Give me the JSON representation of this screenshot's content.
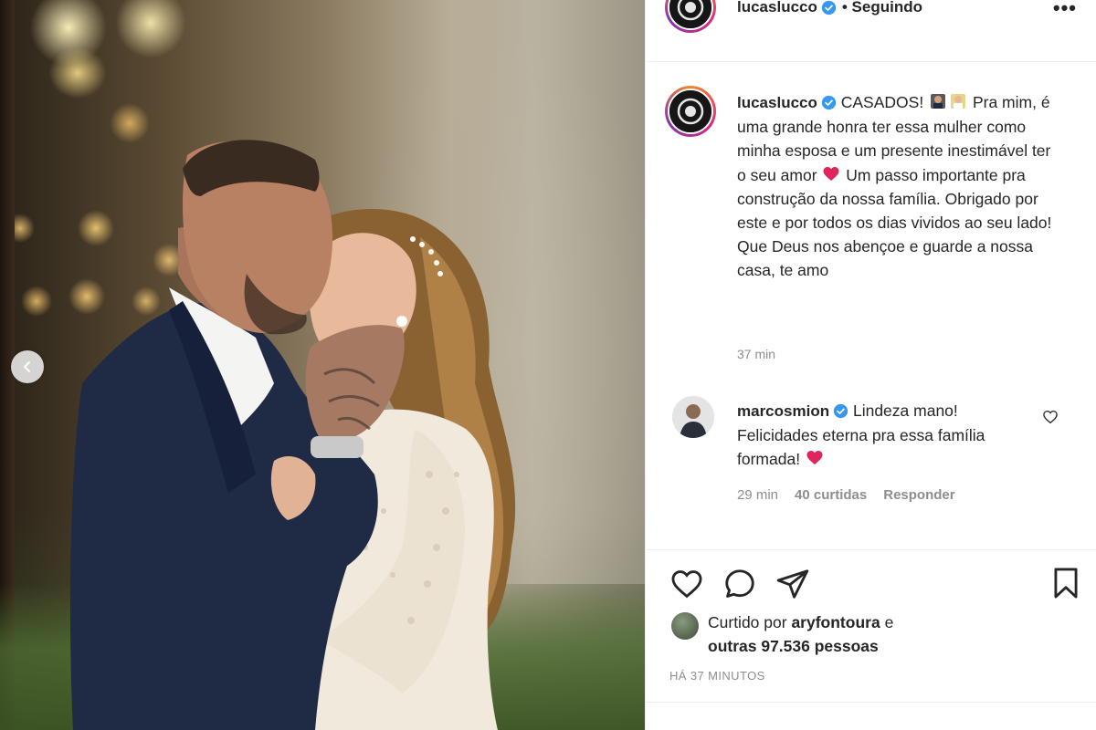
{
  "post": {
    "author": {
      "username": "lucaslucco",
      "verified": true,
      "follow_status": "• Seguindo"
    },
    "caption": {
      "lines": [
        "CASADOS!",
        "Pra mim, é uma grande honra ter essa mulher como minha esposa e um presente inestimável ter o seu amor",
        "Um passo importante pra construção da nossa família. Obrigado por este e por todos os dias vividos ao seu lado! Que Deus nos abençoe e guarde a nossa casa, te amo"
      ],
      "time": "37 min"
    },
    "comment": {
      "username": "marcosmion",
      "verified": true,
      "text": "Lindeza mano! Felicidades eterna pra essa família formada!",
      "time": "29 min",
      "likes": "40 curtidas",
      "reply_label": "Responder"
    },
    "likes_summary": {
      "prefix": "Curtido por",
      "first_user": "aryfontoura",
      "connector": "e",
      "others": "outras 97.536 pessoas"
    },
    "timestamp": "HÁ 37 MINUTOS"
  },
  "icons": {
    "more": "more-options-icon",
    "like": "heart-outline-icon",
    "comment": "comment-bubble-icon",
    "share": "paper-plane-icon",
    "save": "bookmark-outline-icon",
    "verified": "verified-badge-icon",
    "carousel_prev": "chevron-left-icon"
  },
  "colors": {
    "verified": "#3897f0",
    "text": "#262626",
    "muted": "#8e8e8e",
    "heart_emoji": "#e0245e"
  }
}
